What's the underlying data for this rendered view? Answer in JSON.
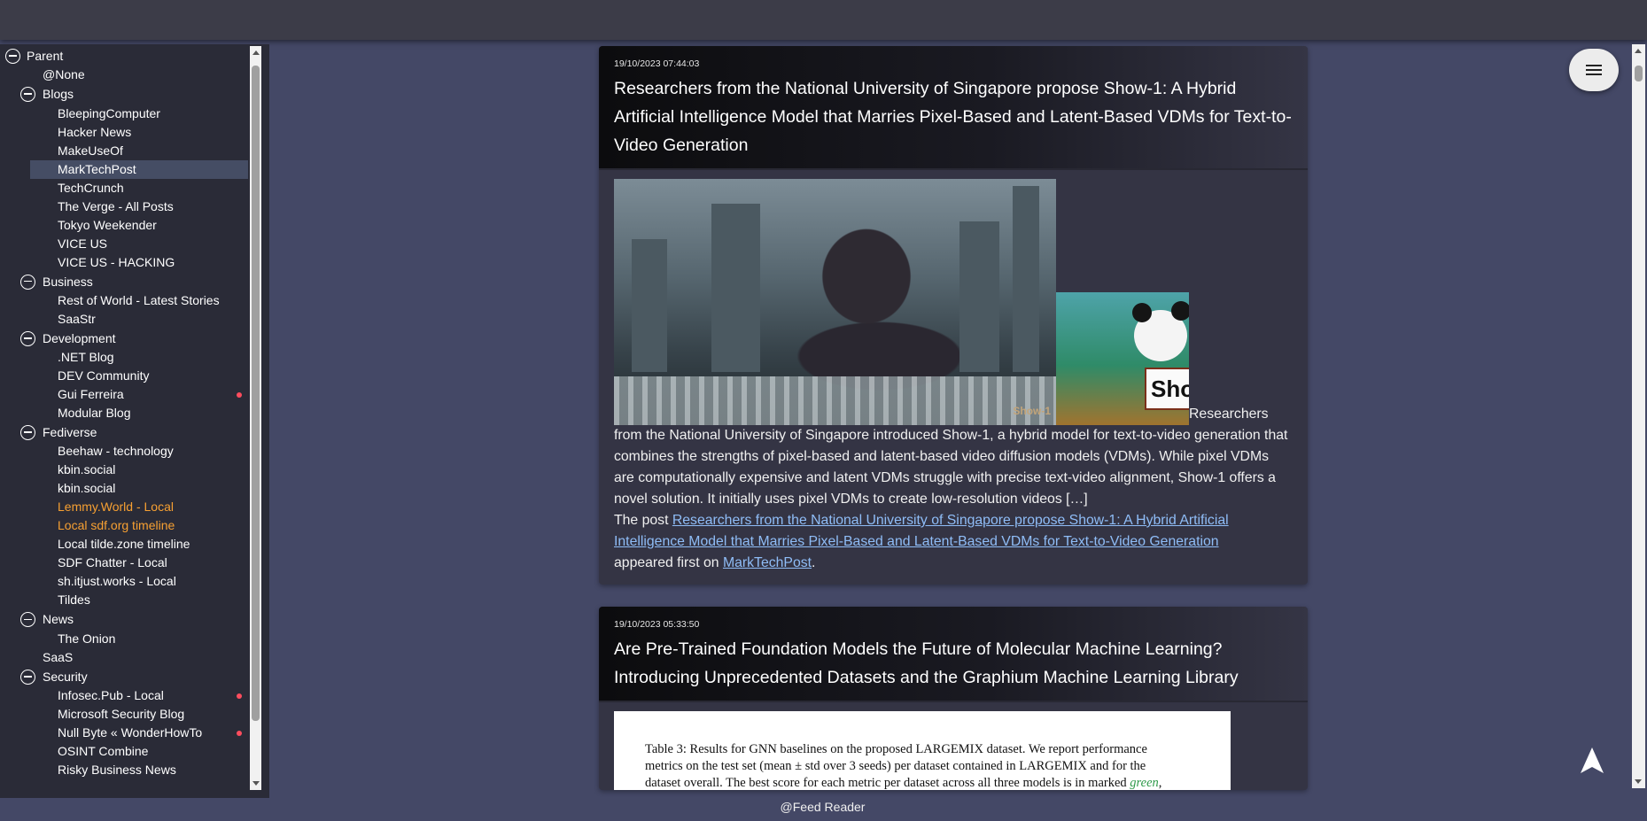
{
  "sidebar": {
    "nodes": [
      {
        "label": "Parent",
        "kind": "group0"
      },
      {
        "label": "@None",
        "kind": "leaf1"
      },
      {
        "label": "Blogs",
        "kind": "group1"
      },
      {
        "label": "BleepingComputer",
        "kind": "leaf2"
      },
      {
        "label": "Hacker News",
        "kind": "leaf2"
      },
      {
        "label": "MakeUseOf",
        "kind": "leaf2"
      },
      {
        "label": "MarkTechPost",
        "kind": "leaf2",
        "selected": true
      },
      {
        "label": "TechCrunch",
        "kind": "leaf2"
      },
      {
        "label": "The Verge - All Posts",
        "kind": "leaf2"
      },
      {
        "label": "Tokyo Weekender",
        "kind": "leaf2"
      },
      {
        "label": "VICE US",
        "kind": "leaf2"
      },
      {
        "label": "VICE US - HACKING",
        "kind": "leaf2"
      },
      {
        "label": "Business",
        "kind": "group1"
      },
      {
        "label": "Rest of World - Latest Stories",
        "kind": "leaf2"
      },
      {
        "label": "SaaStr",
        "kind": "leaf2"
      },
      {
        "label": "Development",
        "kind": "group1"
      },
      {
        "label": ".NET Blog",
        "kind": "leaf2"
      },
      {
        "label": "DEV Community",
        "kind": "leaf2"
      },
      {
        "label": "Gui Ferreira",
        "kind": "leaf2",
        "unread": true
      },
      {
        "label": "Modular Blog",
        "kind": "leaf2"
      },
      {
        "label": "Fediverse",
        "kind": "group1"
      },
      {
        "label": "Beehaw - technology",
        "kind": "leaf2"
      },
      {
        "label": "kbin.social",
        "kind": "leaf2"
      },
      {
        "label": "kbin.social",
        "kind": "leaf2"
      },
      {
        "label": "Lemmy.World - Local",
        "kind": "leaf2",
        "highlight": true
      },
      {
        "label": "Local sdf.org timeline",
        "kind": "leaf2",
        "highlight": true
      },
      {
        "label": "Local tilde.zone timeline",
        "kind": "leaf2"
      },
      {
        "label": "SDF Chatter - Local",
        "kind": "leaf2"
      },
      {
        "label": "sh.itjust.works - Local",
        "kind": "leaf2"
      },
      {
        "label": "Tildes",
        "kind": "leaf2"
      },
      {
        "label": "News",
        "kind": "group1"
      },
      {
        "label": "The Onion",
        "kind": "leaf2"
      },
      {
        "label": "SaaS",
        "kind": "leaf1"
      },
      {
        "label": "Security",
        "kind": "group1"
      },
      {
        "label": "Infosec.Pub - Local",
        "kind": "leaf2",
        "unread": true
      },
      {
        "label": "Microsoft Security Blog",
        "kind": "leaf2"
      },
      {
        "label": "Null Byte « WonderHowTo",
        "kind": "leaf2",
        "unread": true
      },
      {
        "label": "OSINT Combine",
        "kind": "leaf2"
      },
      {
        "label": "Risky Business News",
        "kind": "leaf2"
      }
    ]
  },
  "articles": [
    {
      "date": "19/10/2023 07:44:03",
      "title": "Researchers from the National University of Singapore propose Show-1: A Hybrid Artificial Intelligence Model that Marries Pixel-Based and Latent-Based VDMs for Text-to-Video Generation",
      "image_watermark": "Show-1",
      "panda_sign": "Sho",
      "lead_word": "Researchers",
      "body": "from the National University of Singapore introduced Show-1, a hybrid model for text-to-video generation that combines the strengths of pixel-based and latent-based video diffusion models (VDMs). While pixel VDMs are computationally expensive and latent VDMs struggle with precise text-video alignment, Show-1 offers a novel solution. It initially uses pixel VDMs to create low-resolution videos […]",
      "post_prefix": "The post",
      "post_link": "Researchers from the National University of Singapore propose Show-1: A Hybrid Artificial Intelligence Model that Marries Pixel-Based and Latent-Based VDMs for Text-to-Video Generation",
      "appeared_text": "appeared first on",
      "source_link": "MarkTechPost",
      "end_punct": "."
    },
    {
      "date": "19/10/2023 05:33:50",
      "title": "Are Pre-Trained Foundation Models the Future of Molecular Machine Learning? Introducing Unprecedented Datasets and the Graphium Machine Learning Library",
      "table_caption_1": "Table 3: Results for GNN baselines on the proposed LARGEMIX dataset. We report performance",
      "table_caption_2": "metrics on the test set (mean ± std over 3 seeds) per dataset contained in LARGEMIX and for the",
      "table_caption_3a": "dataset overall. The best score for each metric per dataset across all three models is in marked",
      "table_caption_3b": "green",
      "table_caption_3c": ","
    }
  ],
  "footer": {
    "label": "@Feed Reader"
  },
  "colors": {
    "accent_link": "#8fbdf7",
    "unread_dot": "#ff4d5e",
    "highlight": "#f7a032",
    "background": "#444866"
  }
}
